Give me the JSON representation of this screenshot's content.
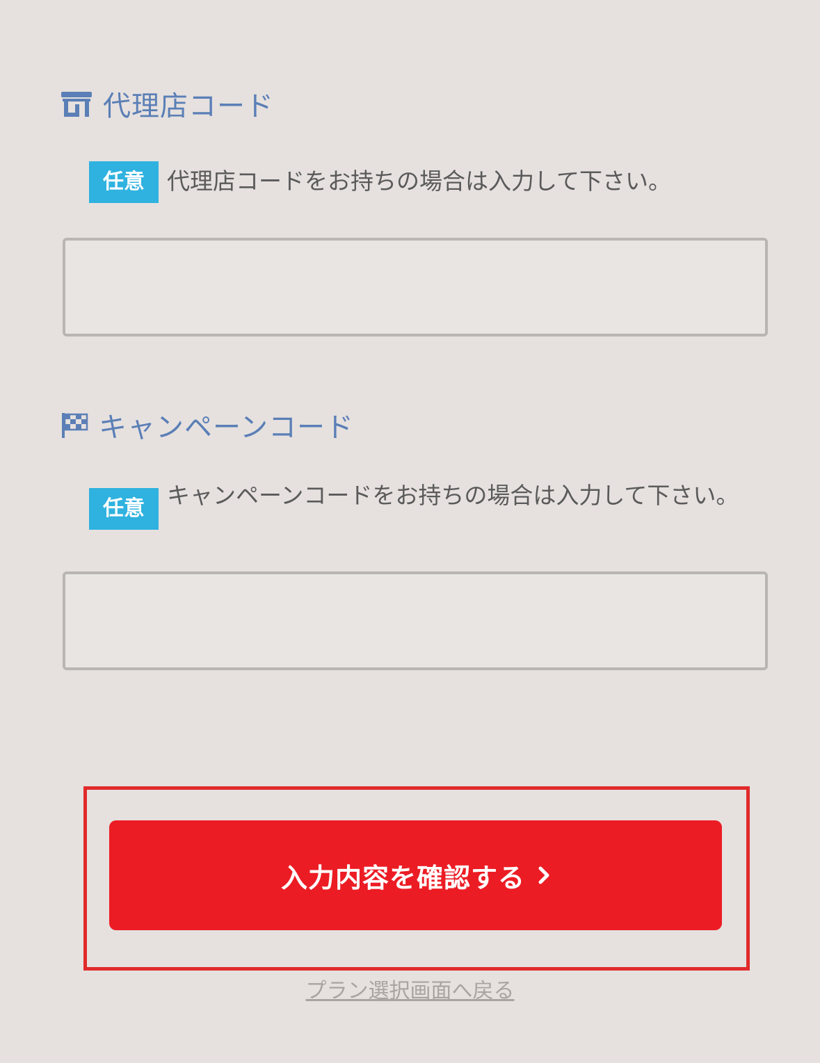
{
  "agency": {
    "title": "代理店コード",
    "badge": "任意",
    "note": "代理店コードをお持ちの場合は入力して下さい。",
    "value": "",
    "icon": "store-icon"
  },
  "campaign": {
    "title": "キャンペーンコード",
    "badge": "任意",
    "note": "キャンペーンコードをお持ちの場合は入力して下さい。",
    "value": "",
    "icon": "checkered-flag-icon"
  },
  "actions": {
    "confirm_label": "入力内容を確認する",
    "back_label": "プラン選択画面へ戻る"
  },
  "colors": {
    "title": "#5b7fb6",
    "badge": "#2fb2df",
    "button": "#ec1c24",
    "highlight": "#e12a2a"
  }
}
